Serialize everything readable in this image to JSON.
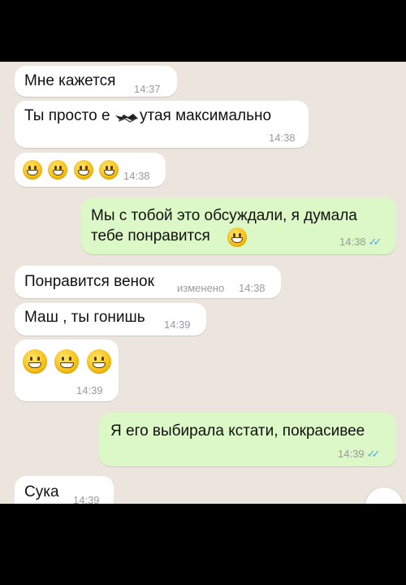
{
  "messages": [
    {
      "dir": "in",
      "text": "Мне кажется",
      "time": "14:37"
    },
    {
      "dir": "in",
      "text": "Ты просто е",
      "text_after": "утая максимально",
      "time": "14:38"
    },
    {
      "dir": "in",
      "emoji": "grinning-face",
      "emoji_count": 4,
      "time": "14:38"
    },
    {
      "dir": "out",
      "text": "Мы с тобой это обсуждали, я думала",
      "text2": "тебе понравится",
      "time": "14:38",
      "read": true
    },
    {
      "dir": "in",
      "text": "Понравится венок",
      "edited": "изменено",
      "time": "14:38"
    },
    {
      "dir": "in",
      "text": "Маш , ты гонишь",
      "time": "14:39"
    },
    {
      "dir": "in",
      "emoji": "grinning-face",
      "emoji_count": 3,
      "time": "14:39"
    },
    {
      "dir": "out",
      "text": "Я его выбирала кстати, покрасивее",
      "time": "14:39",
      "read": true
    },
    {
      "dir": "in",
      "text": "Сука",
      "time": "14:39"
    }
  ],
  "colors": {
    "incoming": "#ffffff",
    "outgoing": "#dcf8c6",
    "background": "#ece5dd",
    "read_ticks": "#4fa8e6"
  },
  "icons": {
    "emoji": "grinning-face-icon",
    "read_receipt": "double-check-icon"
  }
}
